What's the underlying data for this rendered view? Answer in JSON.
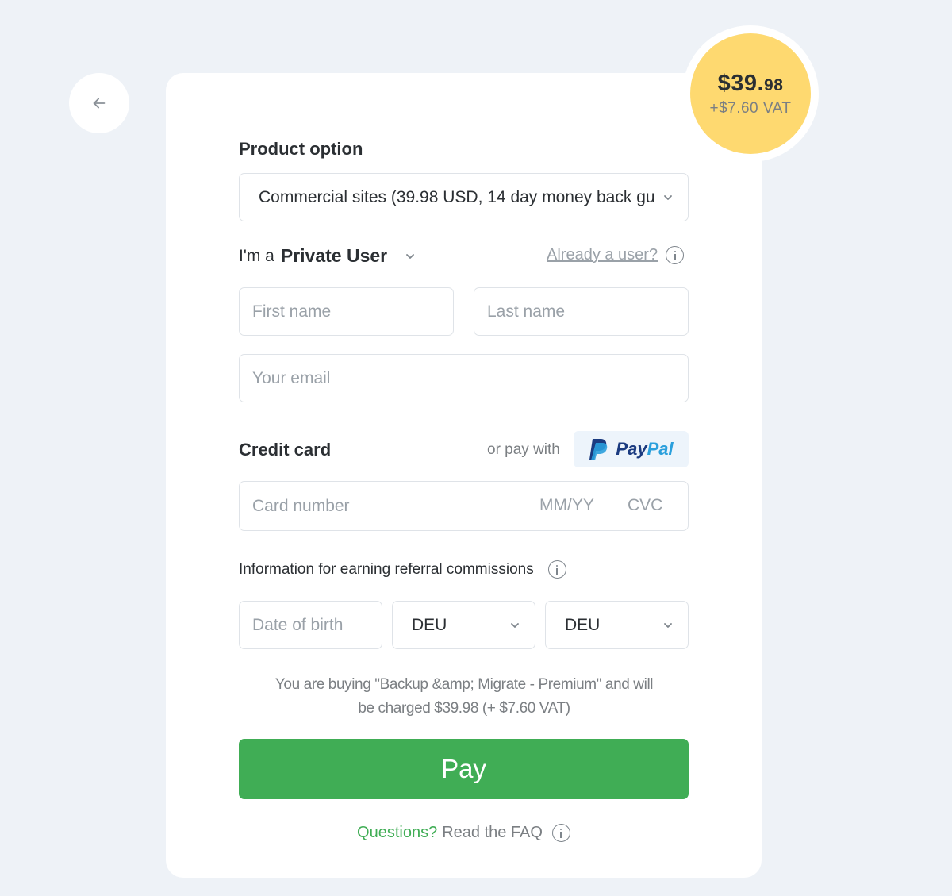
{
  "price": {
    "amount_main": "$39.",
    "amount_cents": "98",
    "vat": "+$7.60 VAT"
  },
  "product": {
    "section_title": "Product option",
    "selected_option": "Commercial sites (39.98 USD, 14 day money back gu"
  },
  "user": {
    "prefix": "I'm a",
    "type": "Private User",
    "already_user_link": "Already a user?"
  },
  "fields": {
    "first_name_placeholder": "First name",
    "last_name_placeholder": "Last name",
    "email_placeholder": "Your email"
  },
  "payment": {
    "section_title": "Credit card",
    "or_pay_with": "or pay with",
    "paypal_part1": "Pay",
    "paypal_part2": "Pal",
    "card_number_placeholder": "Card number",
    "expiry_placeholder": "MM/YY",
    "cvc_placeholder": "CVC"
  },
  "referral": {
    "label": "Information for earning referral commissions",
    "dob_placeholder": "Date of birth",
    "country1": "DEU",
    "country2": "DEU"
  },
  "summary": {
    "line1": "You are buying \"Backup &amp; Migrate - Premium\" and will",
    "line2": "be charged $39.98 (+ $7.60 VAT)"
  },
  "pay_button_label": "Pay",
  "faq": {
    "question": "Questions?",
    "read": "Read the FAQ"
  },
  "colors": {
    "accent_green": "#40ad55",
    "price_badge": "#fed970",
    "background": "#eef2f7"
  }
}
